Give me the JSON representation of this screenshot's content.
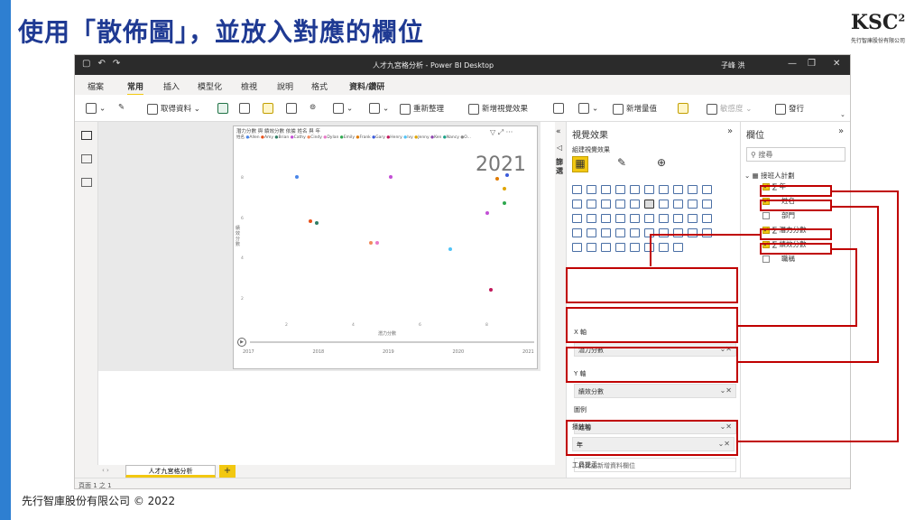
{
  "slide": {
    "title": "使用「散佈圖」，並放入對應的欄位",
    "footer": "先行智庫股份有限公司 © 2022",
    "logo": {
      "mark": "KSC",
      "sup": "2",
      "sub": "先行智庫股份有限公司"
    }
  },
  "app": {
    "window_title": "人才九宮格分析 - Power BI Desktop",
    "user": "子峰 洪",
    "menu_tabs": [
      "檔案",
      "常用",
      "插入",
      "模型化",
      "檢視",
      "說明",
      "格式",
      "資料/鑽研"
    ],
    "active_tab": "常用",
    "ribbon": {
      "get_data": "取得資料",
      "refresh": "重新整理",
      "new_visual": "新增視覺效果",
      "new_measure": "新增量值",
      "sensitivity": "敏感度",
      "publish": "發行"
    },
    "status": "頁面 1 之 1",
    "page_tab": "人才九宮格分析",
    "page_add": "+"
  },
  "visual": {
    "title": "潛力分數 與 績效分數 依據 姓名 與 年",
    "legend_label": "姓名",
    "legend": [
      "Allen",
      "Amy",
      "Brian",
      "Cathy",
      "Cindy",
      "Dylan",
      "Emily",
      "Frank",
      "Gary",
      "Henry",
      "Ivy",
      "Jenny",
      "Ken",
      "Nancy",
      "O..."
    ],
    "year_display": "2021",
    "x_axis_label": "潛力分數",
    "y_axis_label": "績效分數",
    "x_ticks": [
      "2",
      "4",
      "6",
      "8"
    ],
    "y_ticks": [
      "8",
      "6",
      "4",
      "2"
    ],
    "play_years": [
      "2017",
      "2018",
      "2019",
      "2020",
      "2021"
    ]
  },
  "chart_data": {
    "type": "scatter",
    "title": "潛力分數 與 績效分數 依據 姓名 與 年",
    "xlabel": "潛力分數",
    "ylabel": "績效分數",
    "xlim": [
      1,
      9
    ],
    "ylim": [
      1,
      9
    ],
    "points": [
      {
        "x": 2.3,
        "y": 8.1,
        "color": "#4a86e8"
      },
      {
        "x": 5.1,
        "y": 8.1,
        "color": "#c34fd6"
      },
      {
        "x": 8.3,
        "y": 8.0,
        "color": "#e07b00"
      },
      {
        "x": 8.6,
        "y": 8.2,
        "color": "#3b5bdb"
      },
      {
        "x": 8.5,
        "y": 7.5,
        "color": "#e0a500"
      },
      {
        "x": 8.5,
        "y": 6.8,
        "color": "#2fa84f"
      },
      {
        "x": 8.0,
        "y": 6.3,
        "color": "#c34fd6"
      },
      {
        "x": 2.7,
        "y": 5.9,
        "color": "#e8501a"
      },
      {
        "x": 2.9,
        "y": 5.8,
        "color": "#2e7d64"
      },
      {
        "x": 4.5,
        "y": 4.8,
        "color": "#f08a5d"
      },
      {
        "x": 4.7,
        "y": 4.8,
        "color": "#e879c8"
      },
      {
        "x": 6.9,
        "y": 4.5,
        "color": "#4fc3f7"
      },
      {
        "x": 8.1,
        "y": 2.5,
        "color": "#c2185b"
      }
    ]
  },
  "viz_pane": {
    "header": "視覺效果",
    "sub": "組建視覺效果",
    "wells": [
      {
        "label": "X 軸",
        "value": "潛力分數"
      },
      {
        "label": "Y 軸",
        "value": "績效分數"
      },
      {
        "label": "圖例",
        "value": "姓名"
      },
      {
        "label": "大小",
        "value": "於此處新增資料欄位"
      },
      {
        "label": "播放軸",
        "value": "年"
      },
      {
        "label": "工具提示",
        "value": ""
      }
    ]
  },
  "filters_label": "篩選",
  "fields_pane": {
    "header": "欄位",
    "search_placeholder": "搜尋",
    "table": "接班人計劃",
    "fields": [
      {
        "name": "年",
        "checked": true,
        "sigma": true
      },
      {
        "name": "姓名",
        "checked": true,
        "sigma": false
      },
      {
        "name": "部門",
        "checked": false,
        "sigma": false
      },
      {
        "name": "潛力分數",
        "checked": true,
        "sigma": true
      },
      {
        "name": "績效分數",
        "checked": true,
        "sigma": true
      },
      {
        "name": "職稱",
        "checked": false,
        "sigma": false
      }
    ]
  }
}
